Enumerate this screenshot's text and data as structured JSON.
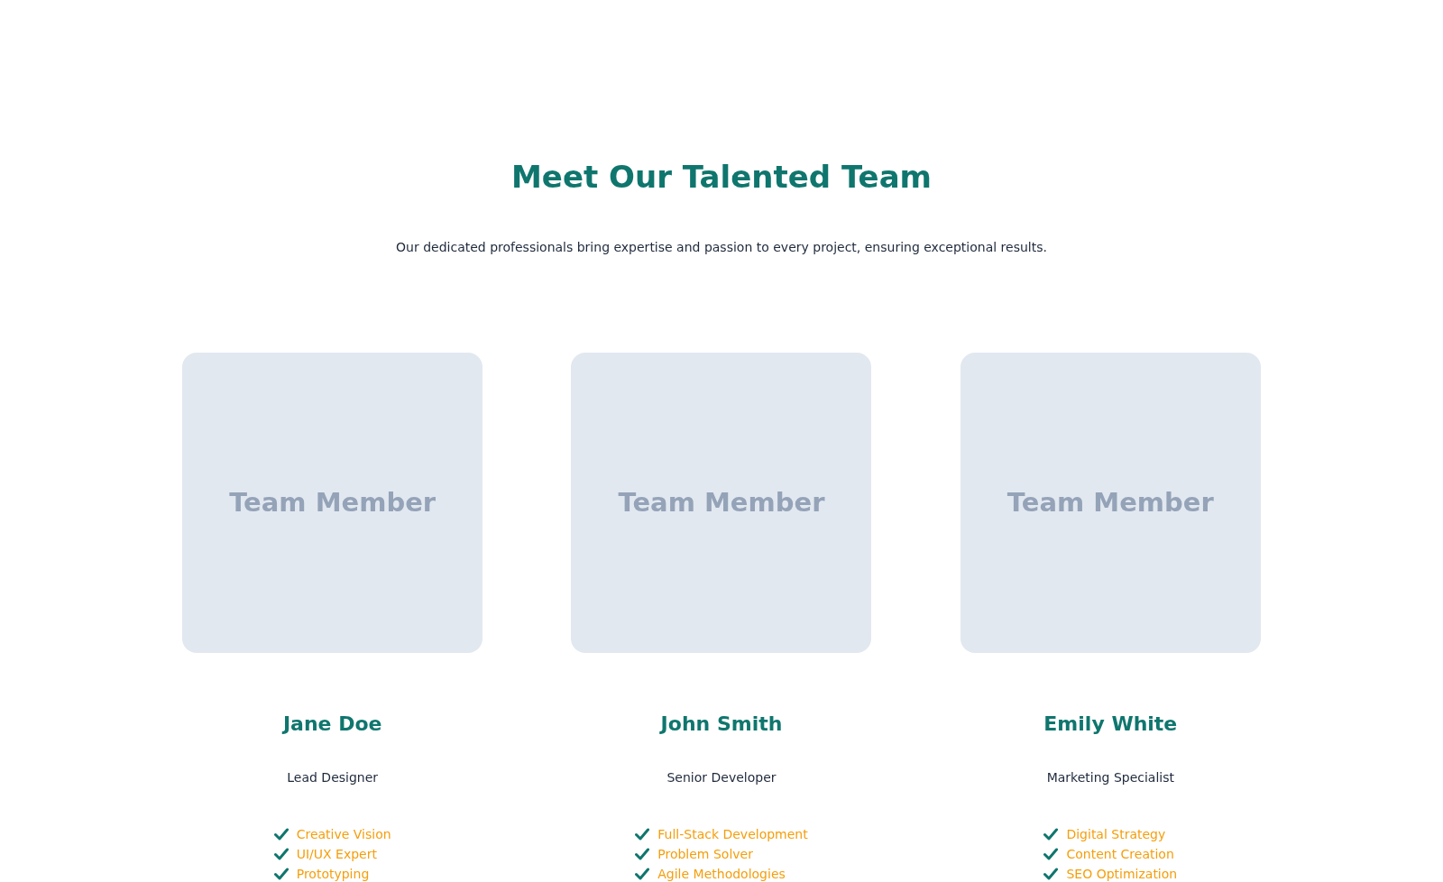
{
  "heading": "Meet Our Talented Team",
  "subtitle": "Our dedicated professionals bring expertise and passion to every project, ensuring exceptional results.",
  "members": [
    {
      "photo_label": "Team Member",
      "name": "Jane Doe",
      "role": "Lead Designer",
      "skills": [
        "Creative Vision",
        "UI/UX Expert",
        "Prototyping"
      ]
    },
    {
      "photo_label": "Team Member",
      "name": "John Smith",
      "role": "Senior Developer",
      "skills": [
        "Full-Stack Development",
        "Problem Solver",
        "Agile Methodologies"
      ]
    },
    {
      "photo_label": "Team Member",
      "name": "Emily White",
      "role": "Marketing Specialist",
      "skills": [
        "Digital Strategy",
        "Content Creation",
        "SEO Optimization"
      ]
    }
  ]
}
